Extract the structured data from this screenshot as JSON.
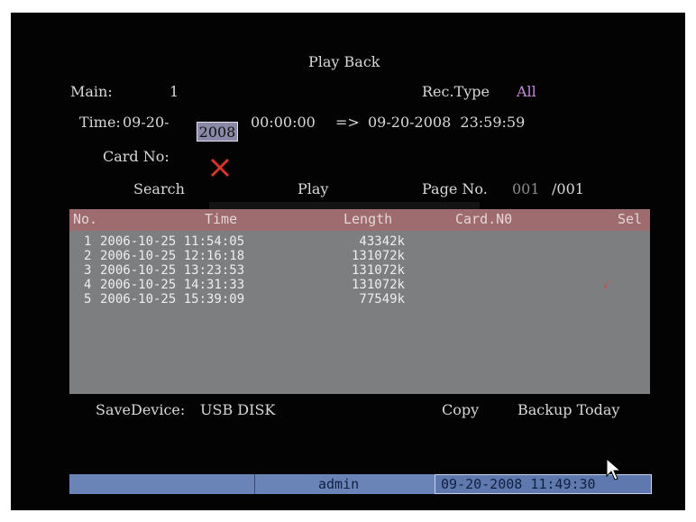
{
  "title": "Play Back",
  "main": {
    "label": "Main:",
    "value": "1"
  },
  "rec_type": {
    "label": "Rec.Type",
    "value": "All"
  },
  "time": {
    "label": "Time:",
    "start_date_prefix": "09-20-",
    "start_year": "2008",
    "start_time": "00:00:00",
    "arrow": "=>",
    "end_datetime": "09-20-2008  23:59:59"
  },
  "card_no": {
    "label": "Card No:",
    "icon": "x-mark-icon"
  },
  "actions": {
    "search": "Search",
    "play": "Play"
  },
  "page": {
    "label": "Page No.",
    "current": "001",
    "total": "/001"
  },
  "table": {
    "headers": {
      "no": "No.",
      "time": "Time",
      "length": "Length",
      "card": "Card.N0",
      "sel": "Sel"
    },
    "rows": [
      {
        "no": "1",
        "time": "2006-10-25 11:54:05",
        "length": "43342k"
      },
      {
        "no": "2",
        "time": "2006-10-25 12:16:18",
        "length": "131072k"
      },
      {
        "no": "3",
        "time": "2006-10-25 13:23:53",
        "length": "131072k"
      },
      {
        "no": "4",
        "time": "2006-10-25 14:31:33",
        "length": "131072k"
      },
      {
        "no": "5",
        "time": "2006-10-25 15:39:09",
        "length": "77549k"
      }
    ],
    "selected_mark": "√"
  },
  "save_device": {
    "label": "SaveDevice:",
    "value": "USB DISK"
  },
  "buttons": {
    "copy": "Copy",
    "backup_today": "Backup Today"
  },
  "status_bar": {
    "user": "admin",
    "datetime": "09-20-2008 11:49:30"
  },
  "colors": {
    "background": "#030303",
    "accent": "#c48ad8",
    "table_header": "#9e6b6e",
    "table_body": "#7c7e80",
    "status_bar": "#6a84b8",
    "x_mark": "#d9342b"
  }
}
